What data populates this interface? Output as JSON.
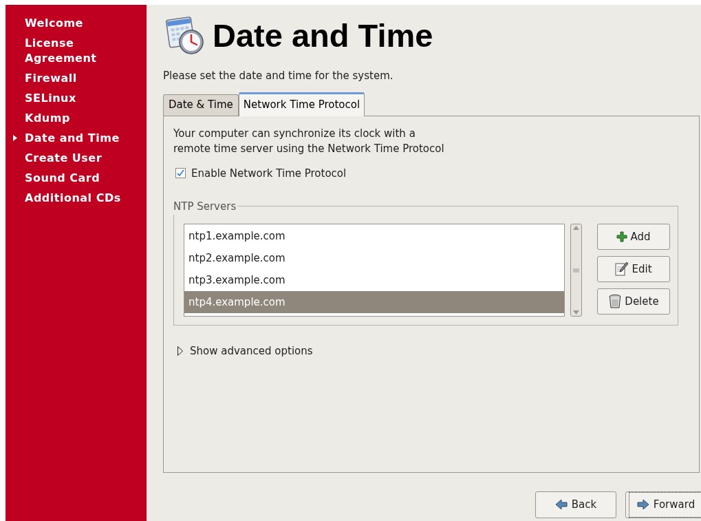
{
  "sidebar": {
    "items": [
      {
        "label": "Welcome",
        "selected": false
      },
      {
        "label": "License Agreement",
        "selected": false
      },
      {
        "label": "Firewall",
        "selected": false
      },
      {
        "label": "SELinux",
        "selected": false
      },
      {
        "label": "Kdump",
        "selected": false
      },
      {
        "label": "Date and Time",
        "selected": true
      },
      {
        "label": "Create User",
        "selected": false
      },
      {
        "label": "Sound Card",
        "selected": false
      },
      {
        "label": "Additional CDs",
        "selected": false
      }
    ]
  },
  "header": {
    "title": "Date and Time"
  },
  "intro": "Please set the date and time for the system.",
  "tabs": [
    {
      "label": "Date & Time",
      "selected": false
    },
    {
      "label": "Network Time Protocol",
      "selected": true
    }
  ],
  "panel": {
    "description": "Your computer can synchronize its clock with a remote time server using the Network Time Protocol",
    "enable_ntp": {
      "label": "Enable Network Time Protocol",
      "checked": true
    },
    "ntp_servers": {
      "title": "NTP Servers",
      "servers": [
        {
          "name": "ntp1.example.com",
          "selected": false
        },
        {
          "name": "ntp2.example.com",
          "selected": false
        },
        {
          "name": "ntp3.example.com",
          "selected": false
        },
        {
          "name": "ntp4.example.com",
          "selected": true
        }
      ],
      "buttons": [
        {
          "label": "Add",
          "kind": "add"
        },
        {
          "label": "Edit",
          "kind": "edit"
        },
        {
          "label": "Delete",
          "kind": "delete"
        }
      ]
    },
    "advanced": {
      "label": "Show advanced options",
      "expanded": false
    }
  },
  "nav": [
    {
      "label": "Back",
      "kind": "back",
      "focused": false
    },
    {
      "label": "Forward",
      "kind": "forward",
      "focused": true
    }
  ]
}
